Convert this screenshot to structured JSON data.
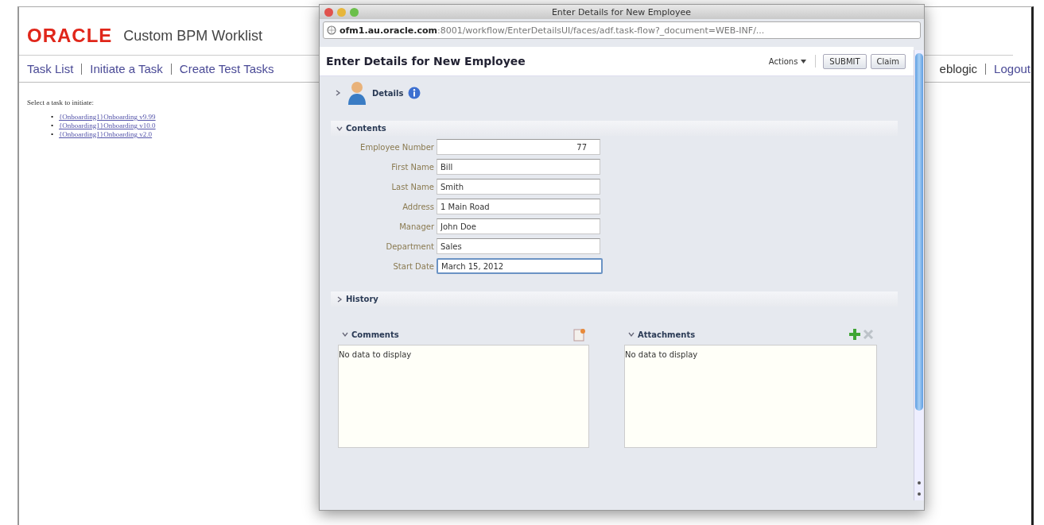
{
  "background_page": {
    "logo": "ORACLE",
    "app_title": "Custom BPM Worklist",
    "nav_links": [
      "Task List",
      "Initiate a Task",
      "Create Test Tasks"
    ],
    "user_links": [
      "eblogic",
      "Logout"
    ],
    "prompt": "Select a task to initiate:",
    "tasks": [
      {
        "bullet": "•",
        "label": "{Onboarding1}Onboarding v9.99"
      },
      {
        "bullet": "•",
        "label": "{Onboarding1}Onboarding v10.0"
      },
      {
        "bullet": "•",
        "label": "{Onboarding1}Onboarding v2.0"
      }
    ]
  },
  "dialog": {
    "window_title": "Enter Details for New Employee",
    "url_host": "ofm1.au.oracle.com",
    "url_rest": ":8001/workflow/EnterDetailsUI/faces/adf.task-flow?_document=WEB-INF/...",
    "heading": "Enter Details for New Employee",
    "actions_menu": "Actions",
    "buttons": [
      "SUBMIT",
      "Claim"
    ],
    "details": {
      "title": "Details",
      "expanded": false
    },
    "contents": {
      "title": "Contents",
      "expanded": true,
      "fields": [
        {
          "label": "Employee Number",
          "value": "77",
          "kind": "number",
          "focused": false
        },
        {
          "label": "First Name",
          "value": "Bill",
          "kind": "text",
          "focused": false
        },
        {
          "label": "Last Name",
          "value": "Smith",
          "kind": "text",
          "focused": false
        },
        {
          "label": "Address",
          "value": "1 Main Road",
          "kind": "text",
          "focused": false
        },
        {
          "label": "Manager",
          "value": "John Doe",
          "kind": "text",
          "focused": false
        },
        {
          "label": "Department",
          "value": "Sales",
          "kind": "text",
          "focused": false
        },
        {
          "label": "Start Date",
          "value": "March 15, 2012",
          "kind": "text",
          "focused": true
        }
      ]
    },
    "history": {
      "title": "History",
      "expanded": false
    },
    "panels": [
      {
        "title": "Comments",
        "expanded": true,
        "kind": "comments",
        "empty_text": "No data to display"
      },
      {
        "title": "Attachments",
        "expanded": true,
        "kind": "attachments",
        "empty_text": "No data to display"
      }
    ]
  }
}
